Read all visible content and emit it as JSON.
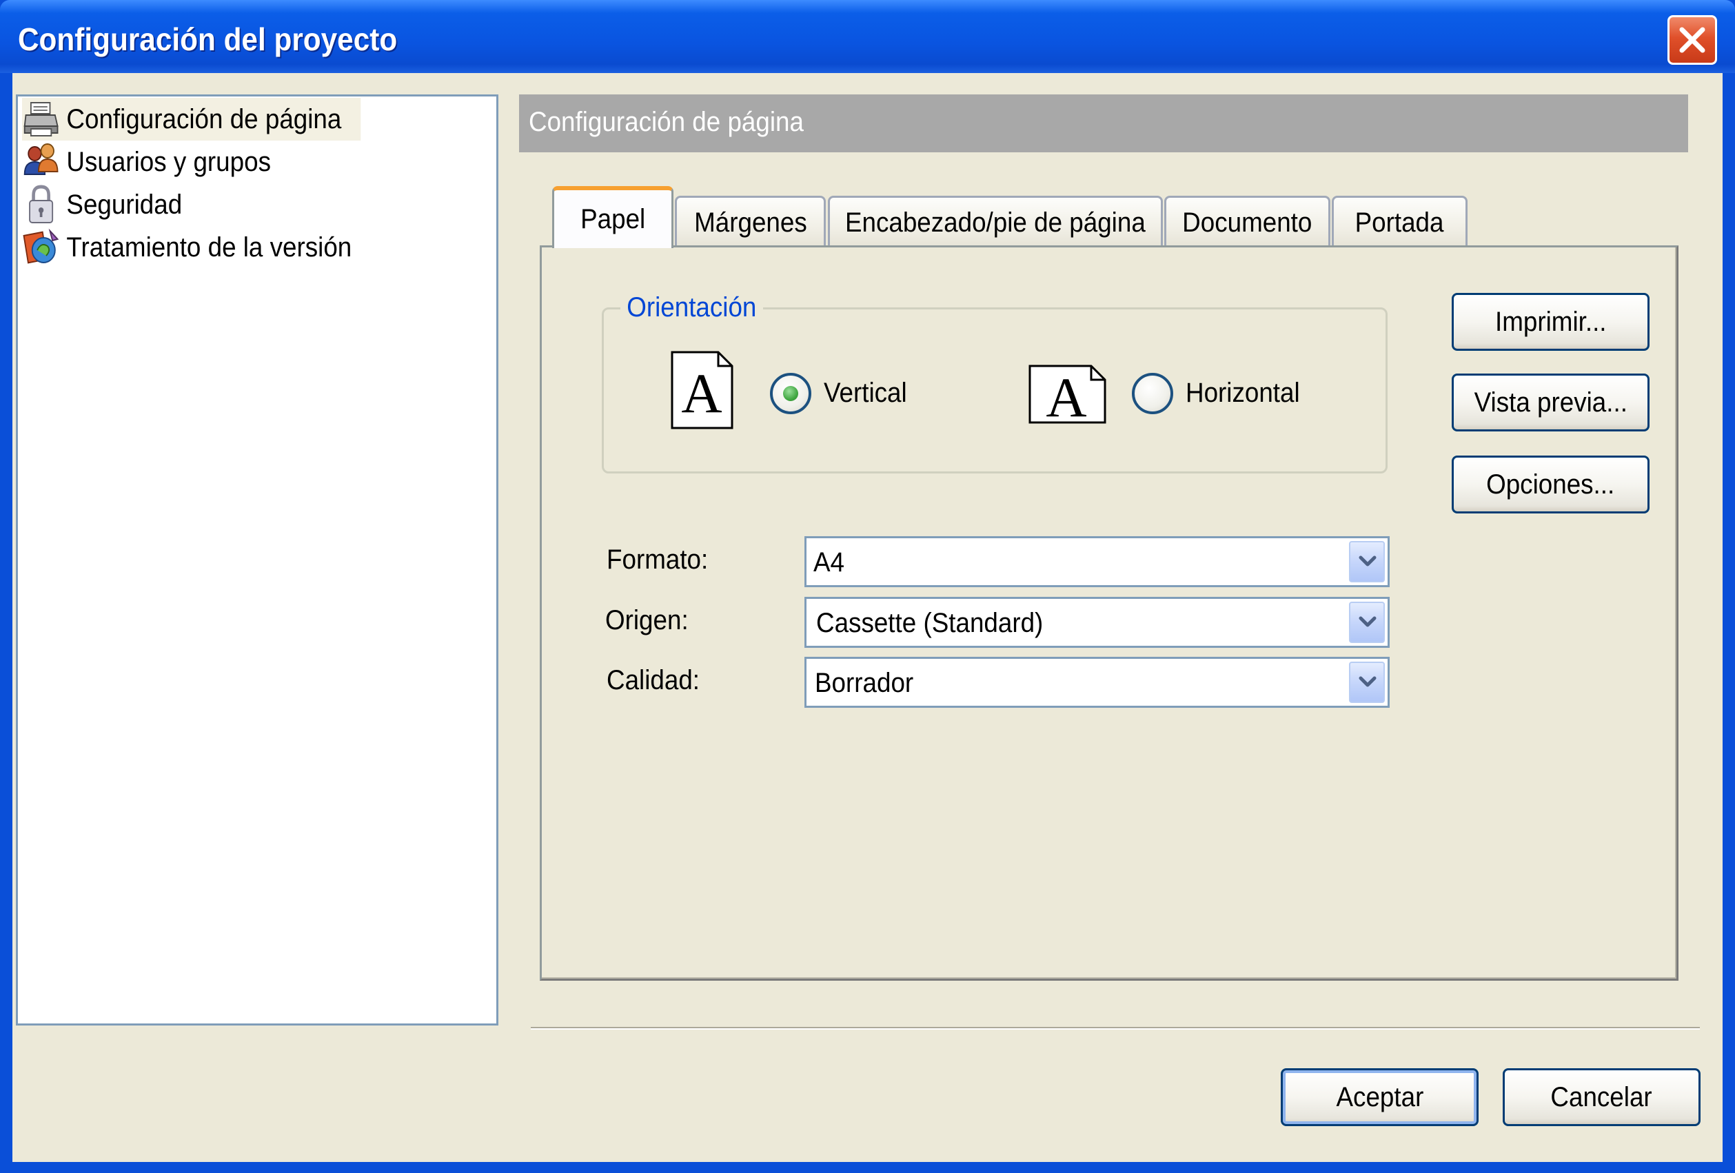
{
  "window": {
    "title": "Configuración del proyecto"
  },
  "tree": {
    "items": [
      {
        "label": "Configuración de página",
        "icon": "printer-icon",
        "selected": true
      },
      {
        "label": "Usuarios y grupos",
        "icon": "users-icon",
        "selected": false
      },
      {
        "label": "Seguridad",
        "icon": "lock-icon",
        "selected": false
      },
      {
        "label": "Tratamiento de la versión",
        "icon": "version-icon",
        "selected": false
      }
    ]
  },
  "panel": {
    "header": "Configuración de página"
  },
  "tabs": [
    {
      "label": "Papel",
      "active": true
    },
    {
      "label": "Márgenes",
      "active": false
    },
    {
      "label": "Encabezado/pie de página",
      "active": false
    },
    {
      "label": "Documento",
      "active": false
    },
    {
      "label": "Portada",
      "active": false
    }
  ],
  "orientation": {
    "legend": "Orientación",
    "options": [
      {
        "label": "Vertical",
        "checked": true,
        "icon": "portrait-page-icon"
      },
      {
        "label": "Horizontal",
        "checked": false,
        "icon": "landscape-page-icon"
      }
    ]
  },
  "fields": {
    "format": {
      "label": "Formato:",
      "value": "A4"
    },
    "source": {
      "label": "Origen:",
      "value": "Cassette (Standard)"
    },
    "quality": {
      "label": "Calidad:",
      "value": "Borrador"
    }
  },
  "side_buttons": {
    "print": "Imprimir...",
    "preview": "Vista previa...",
    "options": "Opciones..."
  },
  "footer": {
    "ok": "Aceptar",
    "cancel": "Cancelar"
  },
  "colors": {
    "titlebar": "#0a54e0",
    "dialog_bg": "#ece9d8",
    "active_tab_accent": "#f7a030",
    "legend_text": "#0046d5"
  }
}
